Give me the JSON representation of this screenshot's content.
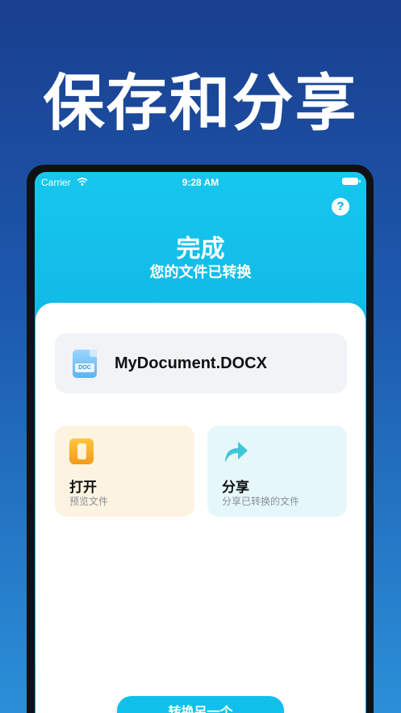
{
  "hero": {
    "title": "保存和分享"
  },
  "status_bar": {
    "carrier": "Carrier",
    "time": "9:28 AM"
  },
  "header": {
    "help_label": "?",
    "title": "完成",
    "subtitle": "您的文件已转换"
  },
  "file": {
    "name": "MyDocument.DOCX",
    "icon_tag": "DOC"
  },
  "actions": [
    {
      "title": "打开",
      "subtitle": "预览文件",
      "icon": "open-file-icon",
      "color": "#f49a1a"
    },
    {
      "title": "分享",
      "subtitle": "分享已转换的文件",
      "icon": "share-arrow-icon",
      "color": "#3ec7d8"
    }
  ],
  "bottom_button": {
    "label": "转换另一个"
  },
  "colors": {
    "accent": "#0aa7dd",
    "background_top": "#1a3f8f",
    "background_bottom": "#2b8fd8"
  }
}
